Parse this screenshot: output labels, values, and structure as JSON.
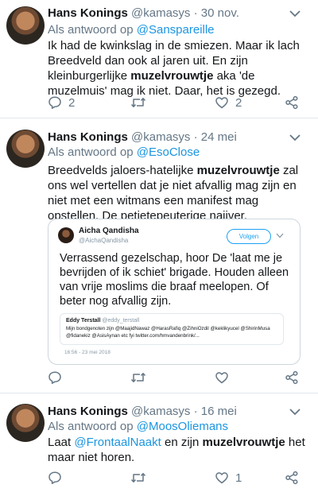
{
  "tweets": [
    {
      "name": "Hans Konings",
      "handle": "@kamasys",
      "sep": "·",
      "date": "30 nov.",
      "reply_prefix": "Als antwoord op",
      "reply_to": "@Sanspareille",
      "body_1": "Ik had de kwinkslag in de smiezen. Maar ik lach Breedveld dan ook al jaren uit. En zijn kleinburgerlijke",
      "body_bold": "muzelvrouwtje",
      "body_2": "aka 'de muzelmuis' mag ik niet. Daar, het is gezegd.",
      "reply_count": "2",
      "retweet_count": "",
      "like_count": "2"
    },
    {
      "name": "Hans Konings",
      "handle": "@kamasys",
      "sep": "·",
      "date": "24 mei",
      "reply_prefix": "Als antwoord op",
      "reply_to": "@EsoClose",
      "body_1": "Breedvelds jaloers-hatelijke",
      "body_bold": "muzelvrouwtje",
      "body_2": "zal ons wel vertellen dat je niet afvallig mag zijn en niet met een witmans een manifest mag opstellen. De petietepeuterige naijver.",
      "reply_count": "",
      "retweet_count": "",
      "like_count": ""
    },
    {
      "name": "Hans Konings",
      "handle": "@kamasys",
      "sep": "·",
      "date": "16 mei",
      "reply_prefix": "Als antwoord op",
      "reply_to": "@MoosOliemans",
      "body_pre": "Laat",
      "body_link": "@FrontaalNaakt",
      "body_1": "en zijn",
      "body_bold": "muzelvrouwtje",
      "body_2": "het maar niet horen.",
      "reply_count": "",
      "retweet_count": "",
      "like_count": "1"
    }
  ],
  "quoted": {
    "name": "Aicha Qandisha",
    "handle": "@AichaQandisha",
    "follow_label": "Volgen",
    "text": "Verrassend gezelschap, hoor  De 'laat me je bevrijden of ik schiet' brigade. Houden alleen van vrije moslims die braaf meelopen. Of beter nog afvallig zijn.",
    "embed_name": "Eddy Terstall",
    "embed_handle": "@eddy_terstall",
    "embed_text": "Mijn bondgenoten zijn @MaajidNawaz @HarasRafiq @ZihniOzdil @keklikyucel @ShirinMusa @fidanekiz @AsisAynan etc fyi twitter.com/hmvandenbrink/...",
    "time": "16:56 - 23 mei 2018"
  },
  "icons": [
    "chevron-down-icon",
    "reply-icon",
    "retweet-icon",
    "like-icon",
    "share-icon"
  ],
  "colors": {
    "link": "#1b95e0",
    "meta": "#657786",
    "separator": "#e1e8ed"
  }
}
